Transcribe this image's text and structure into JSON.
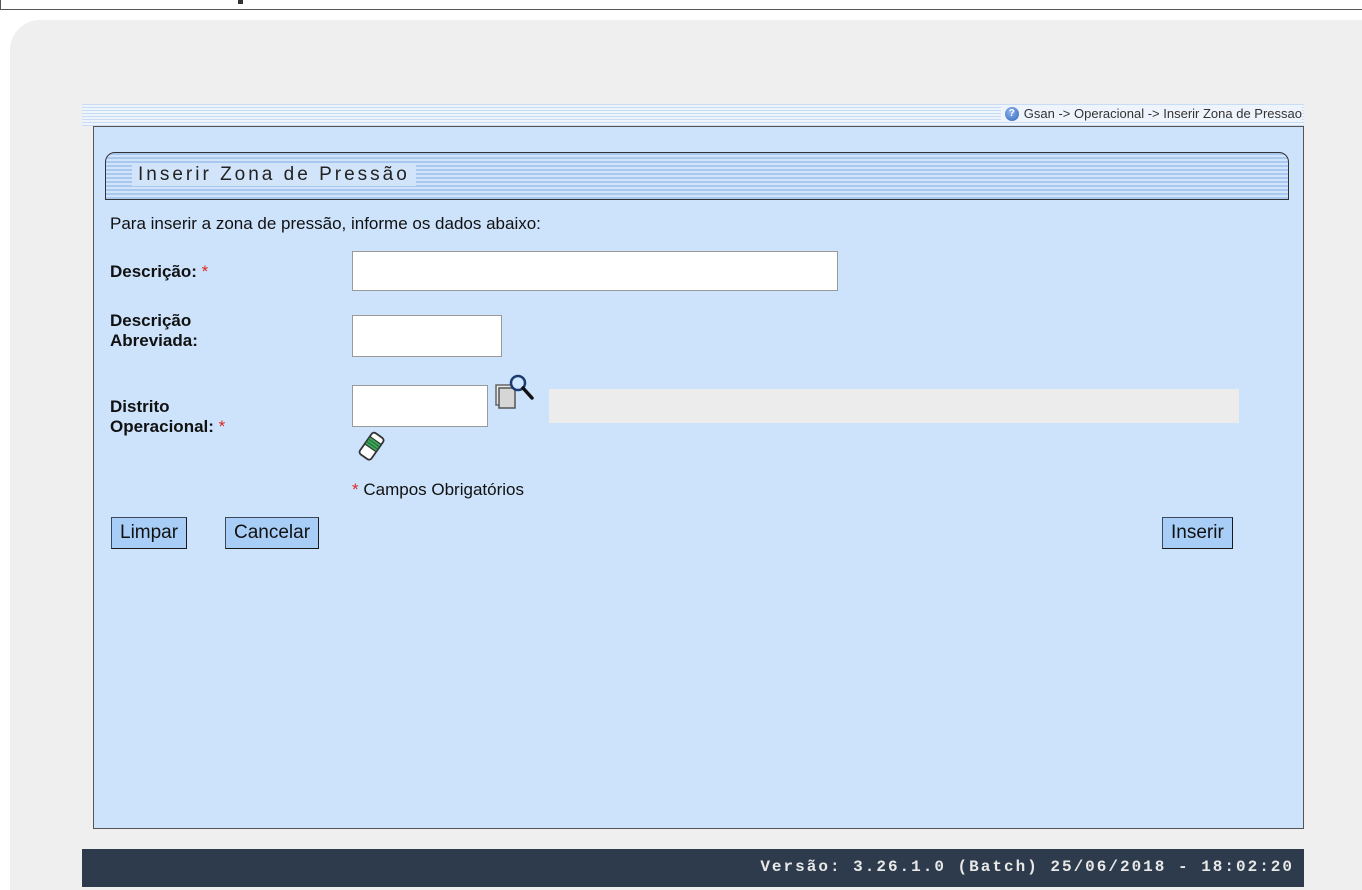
{
  "breadcrumb": {
    "text": "Gsan -> Operacional -> Inserir Zona de Pressao"
  },
  "form": {
    "title": "Inserir Zona de Pressão",
    "intro": "Para inserir a zona de pressão, informe os dados abaixo:",
    "fields": {
      "descricao": {
        "label": "Descrição:",
        "value": "",
        "required": "*"
      },
      "descricao_abreviada": {
        "label_line1": "Descrição",
        "label_line2": "Abreviada:",
        "value": ""
      },
      "distrito_operacional": {
        "label_line1": "Distrito",
        "label_line2": "Operacional:",
        "value": "",
        "required": "*",
        "description_value": ""
      }
    },
    "mandatory_note": {
      "star": "*",
      "text": " Campos Obrigatórios"
    },
    "buttons": {
      "limpar": "Limpar",
      "cancelar": "Cancelar",
      "inserir": "Inserir"
    }
  },
  "footer": {
    "version": "Versão: 3.26.1.0 (Batch) 25/06/2018 - 18:02:20"
  },
  "icons": {
    "help": "help-icon",
    "lookup": "magnifier-icon",
    "clear": "eraser-icon"
  },
  "colors": {
    "panel_bg": "#cde3fc",
    "button_bg": "#a8cdf7",
    "footer_bg": "#2d3b4c",
    "required": "#e0251f"
  }
}
